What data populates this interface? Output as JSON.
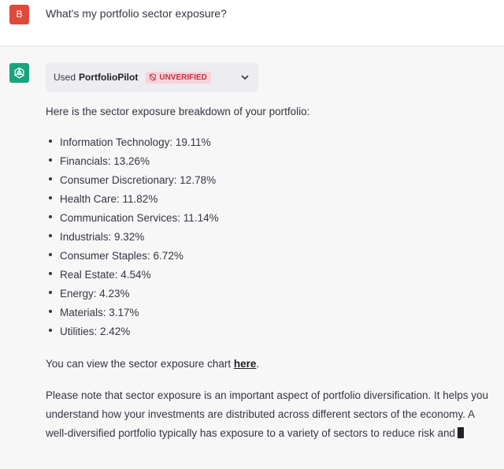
{
  "user_message": {
    "avatar_initial": "B",
    "text": "What's my portfolio sector exposure?"
  },
  "assistant": {
    "avatar_icon": "openai-logo-icon",
    "plugin": {
      "used_label": "Used",
      "name": "PortfolioPilot",
      "badge": "UNVERIFIED",
      "badge_icon": "unverified-shield-icon",
      "chevron_icon": "chevron-down-icon"
    },
    "intro": "Here is the sector exposure breakdown of your portfolio:",
    "sectors": [
      "Information Technology: 19.11%",
      "Financials: 13.26%",
      "Consumer Discretionary: 12.78%",
      "Health Care: 11.82%",
      "Communication Services: 11.14%",
      "Industrials: 9.32%",
      "Consumer Staples: 6.72%",
      "Real Estate: 4.54%",
      "Energy: 4.23%",
      "Materials: 3.17%",
      "Utilities: 2.42%"
    ],
    "view_prefix": "You can view the sector exposure chart ",
    "view_link": "here",
    "view_suffix": ".",
    "note": "Please note that sector exposure is an important aspect of portfolio diversification. It helps you understand how your investments are distributed across different sectors of the economy. A well-diversified portfolio typically has exposure to a variety of sectors to reduce risk and"
  },
  "colors": {
    "user_avatar": "#e04a3a",
    "assistant_avatar": "#19a37f",
    "badge_bg": "#f7d3d7",
    "badge_text": "#c8304a",
    "page_bg": "#f7f7f8"
  }
}
